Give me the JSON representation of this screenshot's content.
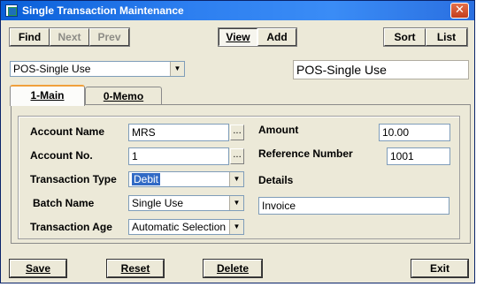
{
  "window": {
    "title": "Single Transaction Maintenance",
    "close_glyph": "✕"
  },
  "toolbar": {
    "find": "Find",
    "next": "Next",
    "prev": "Prev",
    "view": "View",
    "add": "Add",
    "sort": "Sort",
    "list": "List"
  },
  "type_select": {
    "value": "POS-Single Use"
  },
  "type_display": "POS-Single Use",
  "tabs": [
    {
      "label": "1-Main",
      "active": true
    },
    {
      "label": "0-Memo",
      "active": false
    }
  ],
  "form": {
    "account_name": {
      "label": "Account Name",
      "value": "MRS"
    },
    "account_no": {
      "label": "Account No.",
      "value": "1"
    },
    "transaction_type": {
      "label": "Transaction Type",
      "value": "Debit"
    },
    "batch_name": {
      "label": "Batch Name",
      "value": "Single Use"
    },
    "transaction_age": {
      "label": "Transaction Age",
      "value": "Automatic Selection"
    },
    "amount": {
      "label": "Amount",
      "value": "10.00"
    },
    "reference_number": {
      "label": "Reference Number",
      "value": "1001"
    },
    "details": {
      "label": "Details",
      "value": "Invoice"
    }
  },
  "bottom": {
    "save": "Save",
    "reset": "Reset",
    "delete": "Delete",
    "exit": "Exit"
  },
  "glyphs": {
    "ellipsis": "...",
    "dropdown": "▼"
  },
  "colors": {
    "title_bar": "#2d7ff0",
    "selection": "#316ac5",
    "tab_accent": "#f0a03c"
  }
}
